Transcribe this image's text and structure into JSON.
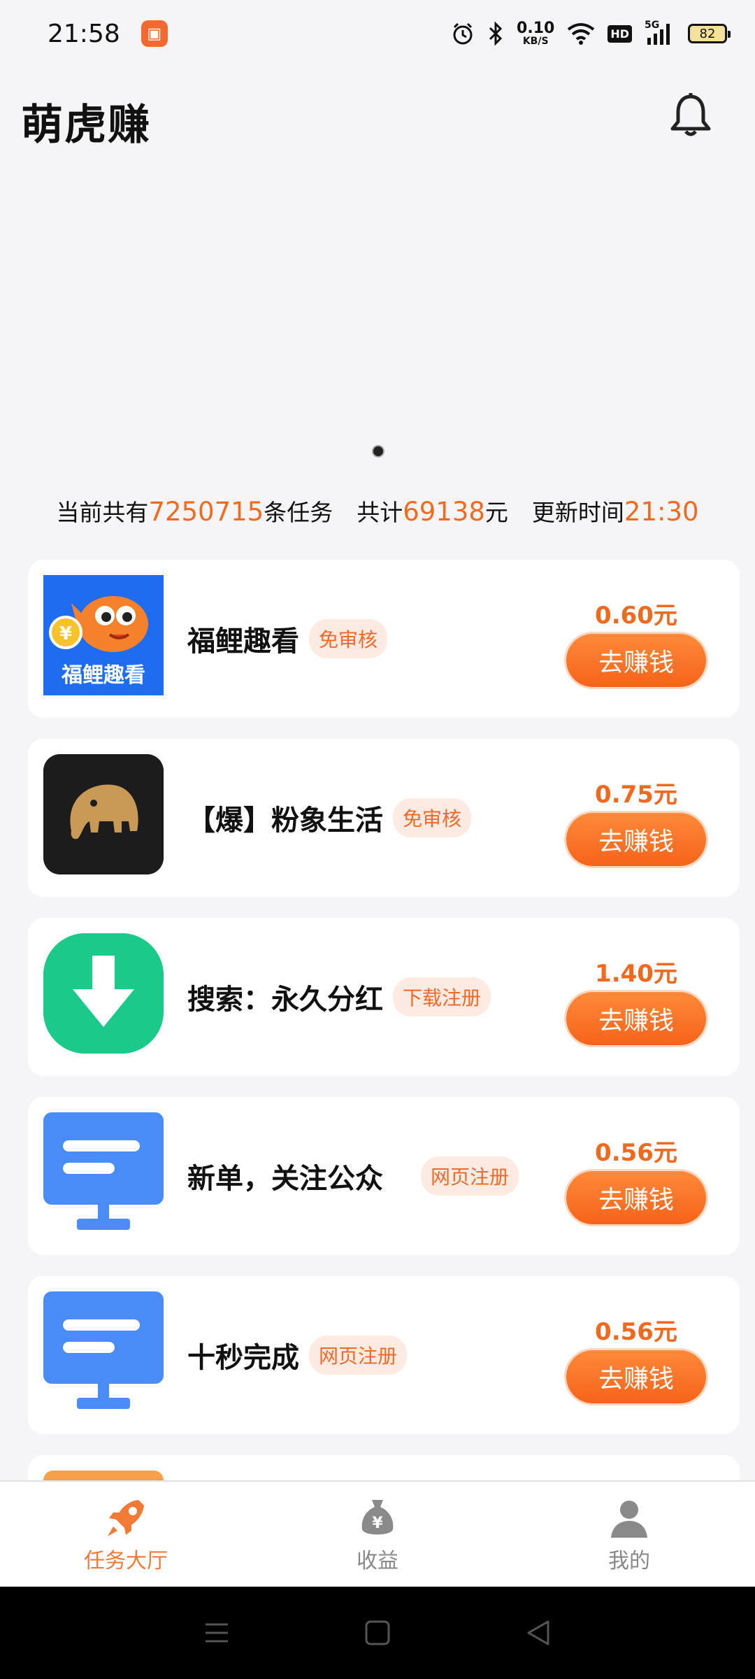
{
  "status_bar": {
    "time": "21:58",
    "net_speed_value": "0.10",
    "net_speed_unit": "KB/S",
    "hd_label": "HD",
    "signal_label": "5G",
    "battery": "82"
  },
  "header": {
    "title": "萌虎赚"
  },
  "stats": {
    "prefix": "当前共有",
    "task_count": "7250715",
    "task_suffix": "条任务",
    "total_prefix": "共计",
    "total_amount": "69138",
    "total_suffix": "元",
    "update_prefix": "更新时间",
    "update_time": "21:30"
  },
  "tasks": [
    {
      "title": "福鲤趣看",
      "tag": "免审核",
      "price": "0.60元",
      "button": "去赚钱",
      "icon": "fish-coin-icon",
      "icon_text": "福鲤趣看"
    },
    {
      "title": "【爆】粉象生活",
      "tag": "免审核",
      "price": "0.75元",
      "button": "去赚钱",
      "icon": "elephant-icon"
    },
    {
      "title": "搜索：永久分红",
      "tag": "下载注册",
      "price": "1.40元",
      "button": "去赚钱",
      "icon": "download-arrow-icon"
    },
    {
      "title": "新单，关注公众",
      "tag": "网页注册",
      "price": "0.56元",
      "button": "去赚钱",
      "icon": "webpage-icon"
    },
    {
      "title": "十秒完成",
      "tag": "网页注册",
      "price": "0.56元",
      "button": "去赚钱",
      "icon": "webpage-icon"
    }
  ],
  "bottom_nav": {
    "items": [
      {
        "label": "任务大厅",
        "icon": "rocket-icon",
        "active": true
      },
      {
        "label": "收益",
        "icon": "money-bag-icon",
        "active": false
      },
      {
        "label": "我的",
        "icon": "person-icon",
        "active": false
      }
    ]
  },
  "colors": {
    "accent": "#f26a1f",
    "tag_bg": "#fdebe1",
    "background": "#f5f5f7"
  }
}
